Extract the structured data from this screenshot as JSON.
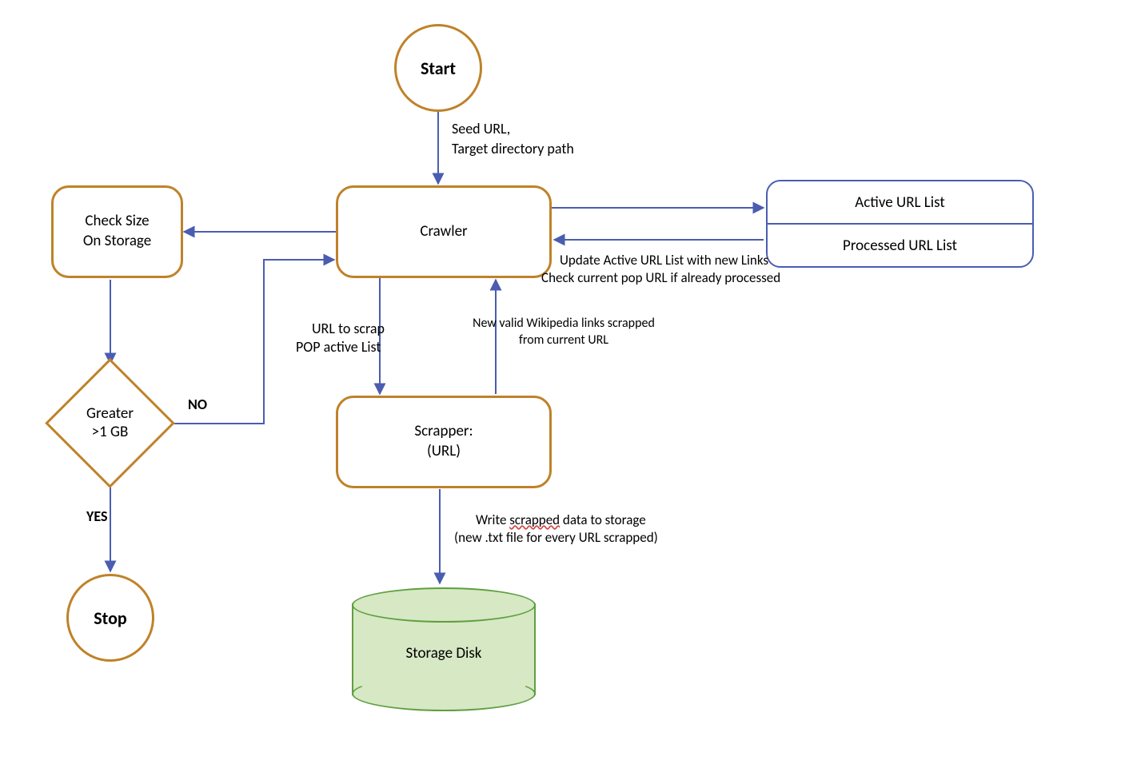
{
  "nodes": {
    "start": "Start",
    "crawler": "Crawler",
    "check_size": "Check Size\nOn Storage",
    "decision": "Greater\n>1 GB",
    "decision_no": "NO",
    "decision_yes": "YES",
    "stop": "Stop",
    "scrapper_l1": "Scrapper:",
    "scrapper_l2": "(URL)",
    "url_list_active": "Active URL List",
    "url_list_processed": "Processed URL List",
    "storage": "Storage Disk"
  },
  "edges": {
    "start_to_crawler_l1": "Seed URL,",
    "start_to_crawler_l2": "Target directory path",
    "crawler_to_scrapper_l1": "URL to scrap",
    "crawler_to_scrapper_l2": "POP active List",
    "scrapper_to_crawler_l1": "New valid Wikipedia links scrapped",
    "scrapper_to_crawler_l2": "from current URL",
    "lists_to_crawler_l1": "Update Active URL List with new Links",
    "lists_to_crawler_l2": "Check current pop URL if already processed",
    "scrapper_to_storage_l1": "Write scrapped data to storage",
    "scrapper_to_storage_l1_squig": "scrapped",
    "scrapper_to_storage_l2": "(new .txt file for every URL scrapped)"
  },
  "colors": {
    "node_border": "#bf8229",
    "arrow": "#4a5db0",
    "cyl_border": "#5f9f3f",
    "cyl_fill": "#d6e8c4"
  }
}
